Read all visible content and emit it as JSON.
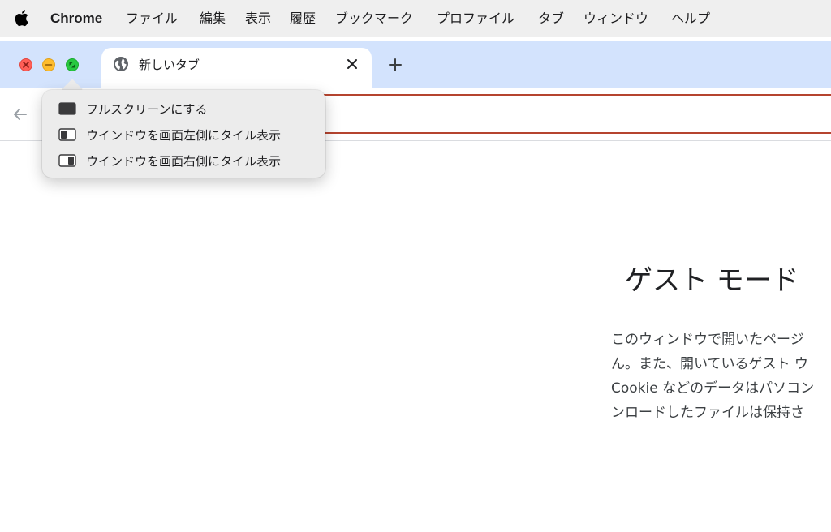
{
  "menubar": {
    "apple_icon": "apple-logo",
    "app_name": "Chrome",
    "items": [
      "ファイル",
      "編集",
      "表示",
      "履歴",
      "ブックマーク",
      "プロファイル",
      "タブ",
      "ウィンドウ",
      "ヘルプ"
    ]
  },
  "window_controls": {
    "close_icon": "close-icon",
    "minimize_icon": "minimize-icon",
    "zoom_icon": "fullscreen-icon"
  },
  "tab": {
    "title": "新しいタブ",
    "icon": "globe-icon",
    "close_icon": "close-icon"
  },
  "new_tab_icon": "plus-icon",
  "toolbar": {
    "back_icon": "back-arrow-icon"
  },
  "popover": {
    "items": [
      {
        "label": "フルスクリーンにする",
        "icon": "fullscreen-window-icon"
      },
      {
        "label": "ウインドウを画面左側にタイル表示",
        "icon": "tile-left-icon"
      },
      {
        "label": "ウインドウを画面右側にタイル表示",
        "icon": "tile-right-icon"
      }
    ]
  },
  "guest": {
    "title": "ゲスト モード",
    "body_lines": [
      "このウィンドウで開いたページ",
      "ん。また、開いているゲスト ウ",
      "Cookie などのデータはパソコン",
      "ンロードしたファイルは保持さ"
    ]
  },
  "colors": {
    "tabstrip": "#d3e3fd",
    "menubar": "#efefef",
    "traffic_red": "#ff5f57",
    "traffic_yellow": "#febc2e",
    "traffic_green": "#28c840",
    "omnibox_border": "#b5442f"
  }
}
